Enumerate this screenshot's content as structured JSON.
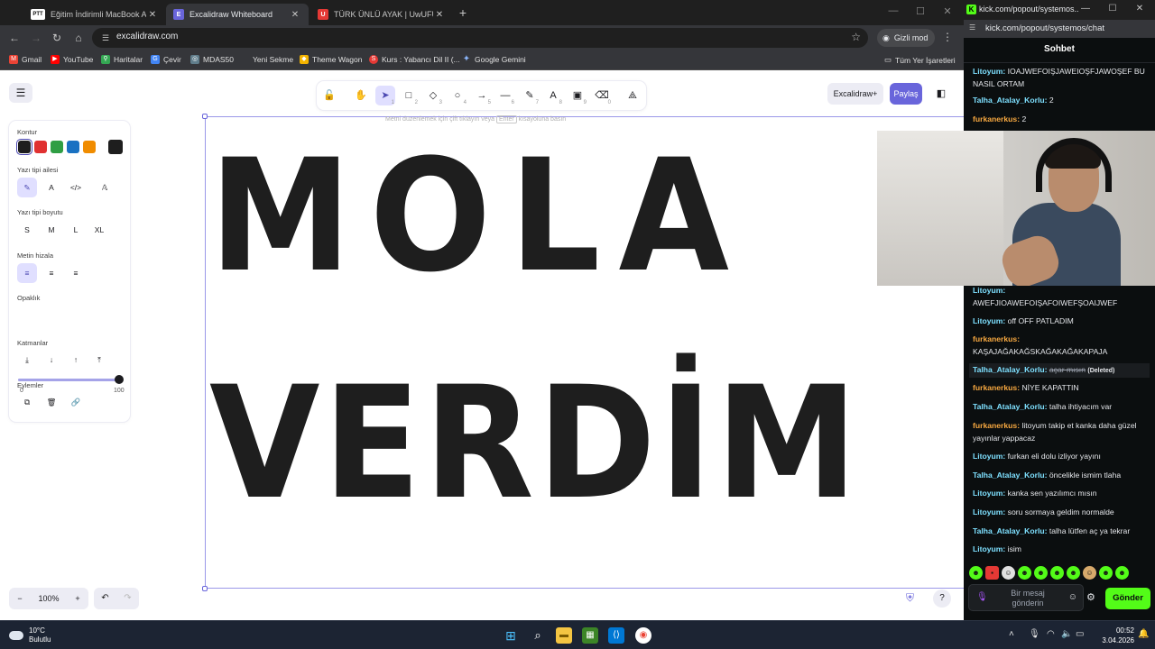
{
  "browser": {
    "tabs": [
      {
        "label": "Eğitim İndirimli MacBook Air M",
        "favicon": "PTT"
      },
      {
        "label": "Excalidraw Whiteboard",
        "favicon": "E"
      },
      {
        "label": "TÜRK ÜNLÜ AYAK | UwUFUFU",
        "favicon": "U"
      }
    ],
    "url": "excalidraw.com",
    "incognito_label": "Gizli mod",
    "bookmarks": [
      {
        "label": "Gmail",
        "color": "#ea4335"
      },
      {
        "label": "YouTube",
        "color": "#ff0000"
      },
      {
        "label": "Haritalar",
        "color": "#34a853"
      },
      {
        "label": "Çevir",
        "color": "#4285f4"
      },
      {
        "label": "MDAS50",
        "color": "#607d8b"
      },
      {
        "label": "Yeni Sekme",
        "color": "#9aa0a6"
      },
      {
        "label": "Theme Wagon",
        "color": "#f4b400"
      },
      {
        "label": "Kurs : Yabancı Dil II (...",
        "color": "#e53935"
      },
      {
        "label": "Google Gemini",
        "color": "#8ab4f8"
      }
    ],
    "all_bookmarks": "Tüm Yer İşaretleri"
  },
  "excalidraw": {
    "library_label": "Excalidraw+",
    "share_label": "Paylaş",
    "edit_hint_before": "Metni düzenlemek için çift tıklayın veya",
    "edit_hint_key": "Enter",
    "edit_hint_after": "kısayoluna basın",
    "canvas_line1": "MOLA",
    "canvas_line2": "VERDİM",
    "tool_keys": [
      "1",
      "2",
      "3",
      "4",
      "5",
      "6",
      "7",
      "8",
      "9",
      "0"
    ],
    "props": {
      "stroke_label": "Kontur",
      "stroke_colors": [
        "#1e1e1e",
        "#e03131",
        "#2f9e44",
        "#1971c2",
        "#f08c00"
      ],
      "stroke_current": "#1e1e1e",
      "font_family_label": "Yazı tipi ailesi",
      "font_size_label": "Yazı tipi boyutu",
      "font_sizes": [
        "S",
        "M",
        "L",
        "XL"
      ],
      "text_align_label": "Metin hizala",
      "opacity_label": "Opaklık",
      "opacity_min": "0",
      "opacity_max": "100",
      "opacity_value": 100,
      "layers_label": "Katmanlar",
      "actions_label": "Eylemler"
    },
    "zoom": "100%"
  },
  "kick": {
    "window_title": "kick.com/popout/systemos...",
    "url": "kick.com/popout/systemos/chat",
    "header": "Sohbet",
    "messages": [
      {
        "user": "Litoyum:",
        "color": "#7ee0ff",
        "text": "IOAJWEFOIŞJAWEIOŞFJAWOŞEF BU NASIL ORTAM"
      },
      {
        "user": "Talha_Atalay_Korlu:",
        "color": "#7ee0ff",
        "text": "2"
      },
      {
        "user": "furkanerkus:",
        "color": "#f7a840",
        "text": "2"
      },
      {
        "user": "Litoyum:",
        "color": "#7ee0ff",
        "text": "AWEFJIOAWEFOIŞAFOIWEFŞOAIJWEF"
      },
      {
        "user": "Litoyum:",
        "color": "#7ee0ff",
        "text": "off OFF PATLADIM"
      },
      {
        "user": "furkanerkus:",
        "color": "#f7a840",
        "text": "KAŞAJAĞAKAĞSKAĞAKAĞAKAPAJA"
      },
      {
        "user": "Talha_Atalay_Korlu:",
        "color": "#7ee0ff",
        "text": "açar mısın",
        "deleted_tag": "(Deleted)"
      },
      {
        "user": "furkanerkus:",
        "color": "#f7a840",
        "text": "NİYE KAPATTIN"
      },
      {
        "user": "Talha_Atalay_Korlu:",
        "color": "#7ee0ff",
        "text": "talha ihtiyacım var"
      },
      {
        "user": "furkanerkus:",
        "color": "#f7a840",
        "text": "litoyum takip et kanka daha güzel yayınlar yappacaz"
      },
      {
        "user": "Litoyum:",
        "color": "#7ee0ff",
        "text": "furkan eli dolu izliyor yayını"
      },
      {
        "user": "Talha_Atalay_Korlu:",
        "color": "#7ee0ff",
        "text": "öncelikle ismim tlaha"
      },
      {
        "user": "Litoyum:",
        "color": "#7ee0ff",
        "text": "kanka sen yazılımcı mısın"
      },
      {
        "user": "Litoyum:",
        "color": "#7ee0ff",
        "text": "soru sormaya geldim normalde"
      },
      {
        "user": "Talha_Atalay_Korlu:",
        "color": "#7ee0ff",
        "text": "talha lütfen aç ya tekrar"
      },
      {
        "user": "Litoyum:",
        "color": "#7ee0ff",
        "text": "isim"
      }
    ],
    "input_placeholder": "Bir mesaj gönderin",
    "send_label": "Gönder"
  },
  "taskbar": {
    "temperature": "10°C",
    "weather": "Bulutlu",
    "time": "00:52",
    "date": "3.04.2026"
  }
}
